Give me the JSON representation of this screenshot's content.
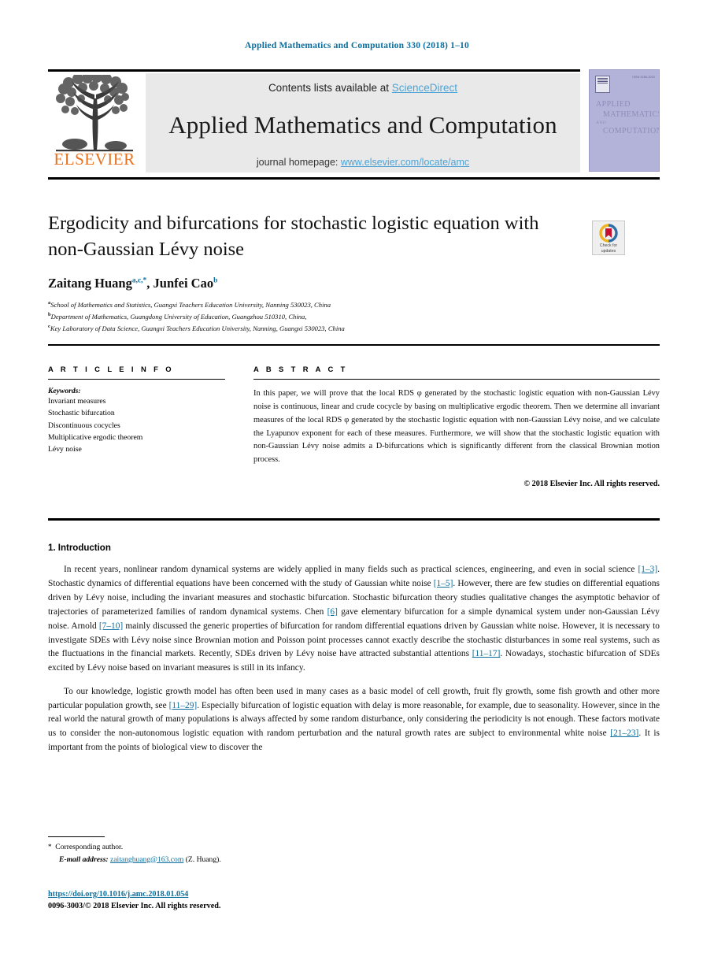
{
  "running_head": "Applied Mathematics and Computation 330 (2018) 1–10",
  "masthead": {
    "contents_prefix": "Contents lists available at ",
    "sciencedirect": "ScienceDirect",
    "journal_title": "Applied Mathematics and Computation",
    "homepage_prefix": "journal homepage: ",
    "homepage_url": "www.elsevier.com/locate/amc",
    "publisher_wordmark": "ELSEVIER",
    "publisher_logo_icon": "elsevier-tree-icon"
  },
  "cover": {
    "issn_text": "ISSN 0096-3003",
    "line1": "APPLIED",
    "line2": "MATHEMATICS",
    "line3": "AND",
    "line4": "COMPUTATION"
  },
  "crossmark": {
    "line1": "Check for",
    "line2": "updates",
    "icon": "crossmark-badge-icon"
  },
  "article": {
    "title": "Ergodicity and bifurcations for stochastic logistic equation with non-Gaussian Lévy noise",
    "authors_html": "Zaitang Huang<sup>a,c,*</sup>, Junfei Cao<sup>b</sup>",
    "affiliations": [
      "School of Mathematics and Statistics, Guangxi Teachers Education University, Nanning 530023, China",
      "Department of Mathematics, Guangdong University of Education, Guangzhou 510310, China,",
      "Key Laboratory of Data Science, Guangxi Teachers Education University, Nanning, Guangxi 530023, China"
    ],
    "affiliation_marks": [
      "a",
      "b",
      "c"
    ]
  },
  "article_info": {
    "heading": "A R T I C L E   I N F O",
    "keywords_label": "Keywords:",
    "keywords": [
      "Invariant measures",
      "Stochastic bifurcation",
      "Discontinuous cocycles",
      "Multiplicative ergodic theorem",
      "Lévy noise"
    ]
  },
  "abstract": {
    "heading": "A B S T R A C T",
    "text": "In this paper, we will prove that the local RDS φ generated by the stochastic logistic equation with non-Gaussian Lévy noise is continuous, linear and crude cocycle by basing on multiplicative ergodic theorem. Then we determine all invariant measures of the local RDS φ generated by the stochastic logistic equation with non-Gaussian Lévy noise, and we calculate the Lyapunov exponent for each of these measures. Furthermore, we will show that the stochastic logistic equation with non-Gaussian Lévy noise admits a D-bifurcations which is significantly different from the classical Brownian motion process.",
    "copyright": "© 2018 Elsevier Inc. All rights reserved."
  },
  "sections": {
    "intro_heading": "1. Introduction",
    "paragraph_1": {
      "part1": "In recent years, nonlinear random dynamical systems are widely applied in many fields such as practical sciences, engineering, and even in social science ",
      "ref1": "[1–3]",
      "part2": ". Stochastic dynamics of differential equations have been concerned with the study of Gaussian white noise ",
      "ref2": "[1–5]",
      "part3": ". However, there are few studies on differential equations driven by Lévy noise, including the invariant measures and stochastic bifurcation. Stochastic bifurcation theory studies qualitative changes the asymptotic behavior of trajectories of parameterized families of random dynamical systems. Chen ",
      "ref3": "[6]",
      "part4": " gave elementary bifurcation for a simple dynamical system under non-Gaussian Lévy noise. Arnold ",
      "ref4": "[7–10]",
      "part5": " mainly discussed the generic properties of bifurcation for random differential equations driven by Gaussian white noise. However, it is necessary to investigate SDEs with Lévy noise since Brownian motion and Poisson point processes cannot exactly describe the stochastic disturbances in some real systems, such as the fluctuations in the financial markets. Recently, SDEs driven by Lévy noise have attracted substantial attentions ",
      "ref5": "[11–17]",
      "part6": ". Nowadays, stochastic bifurcation of SDEs excited by Lévy noise based on invariant measures is still in its infancy."
    },
    "paragraph_2": {
      "part1": "To our knowledge, logistic growth model has often been used in many cases as a basic model of cell growth, fruit fly growth, some fish growth and other more particular population growth, see ",
      "ref1": "[11–29]",
      "part2": ". Especially bifurcation of logistic equation with delay is more reasonable, for example, due to seasonality. However, since in the real world the natural growth of many populations is always affected by some random disturbance, only considering the periodicity is not enough. These factors motivate us to consider the non-autonomous logistic equation with random perturbation and the natural growth rates are subject to environmental white noise ",
      "ref2": "[21–23]",
      "part3": ". It is important from the points of biological view to discover the"
    }
  },
  "footer": {
    "corresponding": "Corresponding author.",
    "email_label": "E-mail address: ",
    "email": "zaitanghuang@163.com",
    "email_suffix": " (Z. Huang).",
    "doi": "https://doi.org/10.1016/j.amc.2018.01.054",
    "issn_line": "0096-3003/© 2018 Elsevier Inc. All rights reserved."
  },
  "colors": {
    "link": "#0b6e9e",
    "sciencedirect": "#4da3d6",
    "elsevier_orange": "#E9711C",
    "band_gray": "#e9e9e9",
    "cover_purple": "#b3b3d9"
  }
}
